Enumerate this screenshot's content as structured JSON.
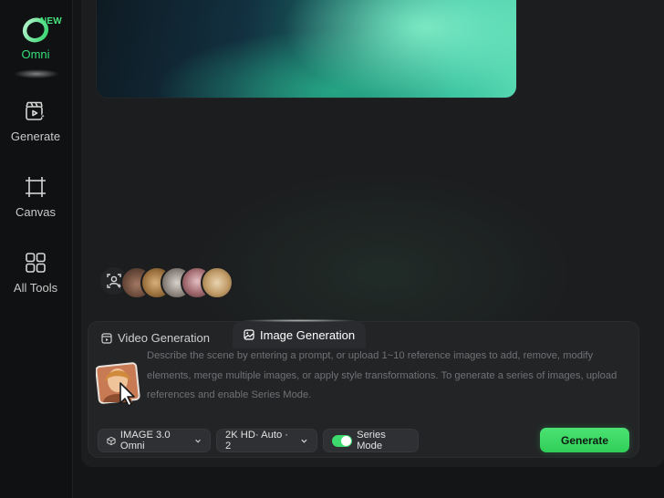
{
  "sidebar": {
    "items": [
      {
        "label": "Omni",
        "badge": "NEW",
        "icon": "omni-logo-icon"
      },
      {
        "label": "Generate",
        "icon": "clapperboard-sparkle-icon"
      },
      {
        "label": "Canvas",
        "icon": "crop-frame-icon"
      },
      {
        "label": "All Tools",
        "icon": "grid-four-icon"
      }
    ]
  },
  "avatars": {
    "add_icon": "person-add-icon",
    "count": 5
  },
  "panel": {
    "tabs": [
      {
        "label": "Video Generation",
        "icon": "video-icon",
        "active": false
      },
      {
        "label": "Image Generation",
        "icon": "image-icon",
        "active": true
      }
    ],
    "prompt_placeholder": "Describe the scene by entering a prompt, or upload 1~10 reference images to add, remove, modify elements, merge multiple images, or apply style transformations. To generate a series of images, upload references and enable Series Mode.",
    "upload_icon": "image-upload-icon",
    "controls": {
      "model": "IMAGE 3.0 Omni",
      "resolution": "2K HD· Auto · 2",
      "series_mode_label": "Series Mode",
      "series_mode_on": true,
      "generate_label": "Generate"
    }
  },
  "colors": {
    "accent": "#3ddb6e",
    "background": "#141516",
    "panel": "#232426"
  }
}
